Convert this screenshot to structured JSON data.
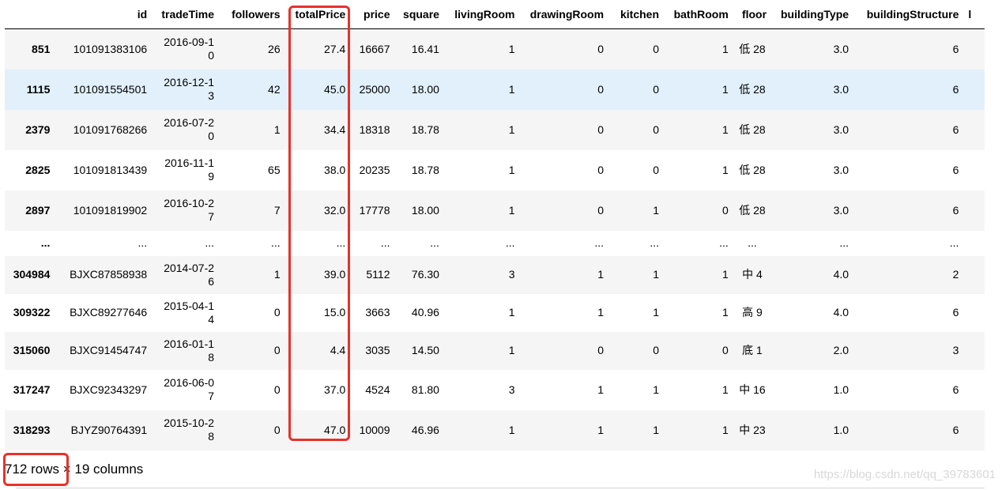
{
  "dataframe": {
    "columns": [
      "",
      "id",
      "tradeTime",
      "followers",
      "totalPrice",
      "price",
      "square",
      "livingRoom",
      "drawingRoom",
      "kitchen",
      "bathRoom",
      "floor",
      "buildingType",
      "buildingStructure",
      "l"
    ],
    "rows": [
      [
        "851",
        "101091383106",
        "2016-09-10",
        "26",
        "27.4",
        "16667",
        "16.41",
        "1",
        "0",
        "0",
        "1",
        "低 28",
        "3.0",
        "6"
      ],
      [
        "1115",
        "101091554501",
        "2016-12-13",
        "42",
        "45.0",
        "25000",
        "18.00",
        "1",
        "0",
        "0",
        "1",
        "低 28",
        "3.0",
        "6"
      ],
      [
        "2379",
        "101091768266",
        "2016-07-20",
        "1",
        "34.4",
        "18318",
        "18.78",
        "1",
        "0",
        "0",
        "1",
        "低 28",
        "3.0",
        "6"
      ],
      [
        "2825",
        "101091813439",
        "2016-11-19",
        "65",
        "38.0",
        "20235",
        "18.78",
        "1",
        "0",
        "0",
        "1",
        "低 28",
        "3.0",
        "6"
      ],
      [
        "2897",
        "101091819902",
        "2016-10-27",
        "7",
        "32.0",
        "17778",
        "18.00",
        "1",
        "0",
        "1",
        "0",
        "低 28",
        "3.0",
        "6"
      ],
      [
        "...",
        "...",
        "...",
        "...",
        "...",
        "...",
        "...",
        "...",
        "...",
        "...",
        "...",
        "...",
        "...",
        "..."
      ],
      [
        "304984",
        "BJXC87858938",
        "2014-07-26",
        "1",
        "39.0",
        "5112",
        "76.30",
        "3",
        "1",
        "1",
        "1",
        "中 4",
        "4.0",
        "2"
      ],
      [
        "309322",
        "BJXC89277646",
        "2015-04-14",
        "0",
        "15.0",
        "3663",
        "40.96",
        "1",
        "1",
        "1",
        "1",
        "高 9",
        "4.0",
        "6"
      ],
      [
        "315060",
        "BJXC91454747",
        "2016-01-18",
        "0",
        "4.4",
        "3035",
        "14.50",
        "1",
        "0",
        "0",
        "0",
        "底 1",
        "2.0",
        "3"
      ],
      [
        "317247",
        "BJXC92343297",
        "2016-06-07",
        "0",
        "37.0",
        "4524",
        "81.80",
        "3",
        "1",
        "1",
        "1",
        "中 16",
        "1.0",
        "6"
      ],
      [
        "318293",
        "BJYZ90764391",
        "2015-10-28",
        "0",
        "47.0",
        "10009",
        "46.96",
        "1",
        "1",
        "1",
        "1",
        "中 23",
        "1.0",
        "6"
      ]
    ]
  },
  "shape": {
    "rows_text": "712 rows",
    "cols_text": "× 19 columns"
  },
  "watermark": "https://blog.csdn.net/qq_39783601",
  "colors": {
    "highlight_box": "#e83129",
    "hover_row": "#e1f0fb",
    "stripe_row": "#f5f5f5"
  }
}
